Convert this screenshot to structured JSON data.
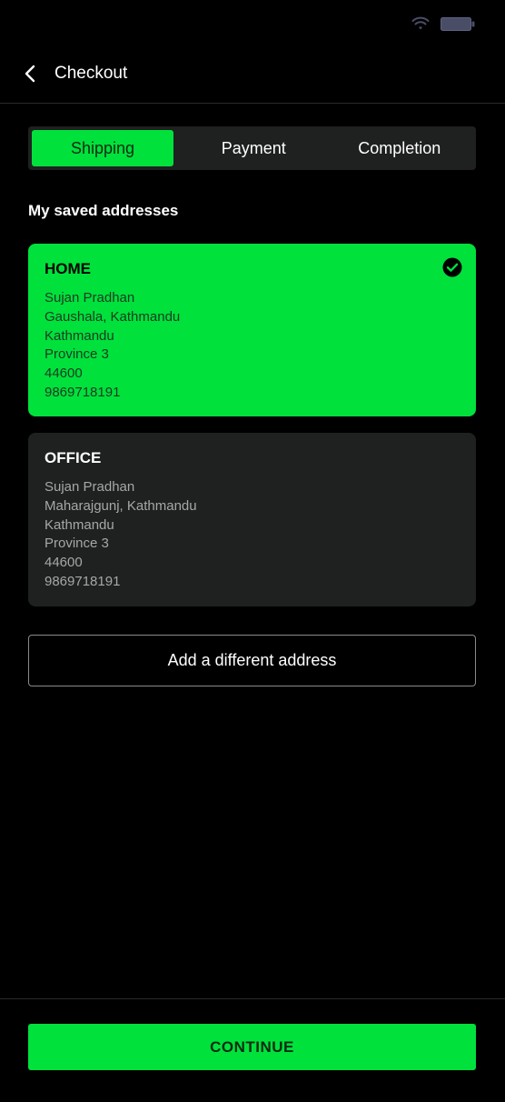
{
  "header": {
    "title": "Checkout",
    "back_icon": "chevron-left-icon"
  },
  "status_bar": {
    "wifi_icon": "wifi-icon",
    "battery_icon": "battery-icon"
  },
  "tabs": [
    {
      "label": "Shipping",
      "active": true
    },
    {
      "label": "Payment",
      "active": false
    },
    {
      "label": "Completion",
      "active": false
    }
  ],
  "section": {
    "title": "My saved addresses"
  },
  "addresses": [
    {
      "title": "HOME",
      "selected": true,
      "lines": [
        "Sujan Pradhan",
        "Gaushala, Kathmandu",
        "Kathmandu",
        "Province 3",
        "44600",
        "9869718191"
      ]
    },
    {
      "title": "OFFICE",
      "selected": false,
      "lines": [
        "Sujan Pradhan",
        "Maharajgunj, Kathmandu",
        "Kathmandu",
        "Province 3",
        "44600",
        "9869718191"
      ]
    }
  ],
  "add_address": {
    "label": "Add a different address"
  },
  "footer": {
    "continue_label": "CONTINUE"
  },
  "colors": {
    "accent": "#00e13c",
    "background": "#000000",
    "card": "#1f2020"
  }
}
